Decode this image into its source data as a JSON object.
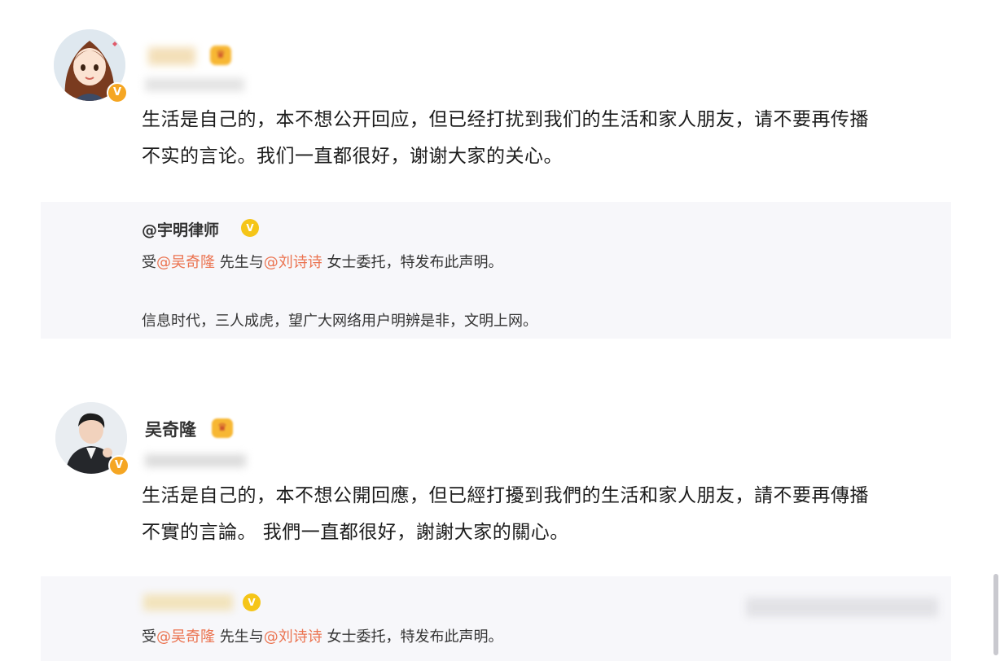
{
  "post1": {
    "author_name": "",
    "meta": "",
    "text_line1": "生活是自己的，本不想公开回应，但已经打扰到我们的生活和家人朋友，请不要再传播",
    "text_line2": "不实的言论。我们一直都很好，谢谢大家的关心。",
    "quote": {
      "author": "@宇明律师",
      "line1_prefix": "受",
      "mention1": "@吴奇隆",
      "line1_mid": " 先生与",
      "mention2": "@刘诗诗",
      "line1_suffix": " 女士委托，特发布此声明。",
      "line2": "信息时代，三人成虎，望广大网络用户明辨是非，文明上网。"
    }
  },
  "post2": {
    "author_name": "吴奇隆",
    "meta": "",
    "text_line1": "生活是自己的，本不想公開回應，但已經打擾到我們的生活和家人朋友，請不要再傳播",
    "text_line2": "不實的言論。 我們一直都很好，謝謝大家的關心。",
    "quote": {
      "author": "",
      "line1_prefix": "受",
      "mention1": "@吴奇隆",
      "line1_mid": " 先生与",
      "mention2": "@刘诗诗",
      "line1_suffix": " 女士委托，特发布此声明。"
    }
  },
  "icons": {
    "verified": "verified-badge-icon",
    "crown": "vip-crown-icon"
  },
  "colors": {
    "mention": "#eb7350",
    "verified_badge": "#f5a623",
    "quote_bg": "#f7f7fa"
  }
}
